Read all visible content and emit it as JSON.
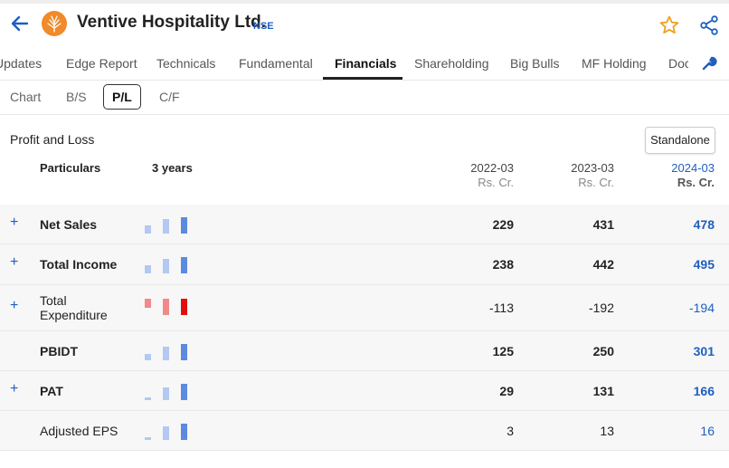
{
  "header": {
    "company_name": "Ventive Hospitality Ltd.",
    "exchange": "NSE",
    "icons": [
      "back-arrow-icon",
      "company-logo",
      "star-icon",
      "share-icon"
    ]
  },
  "tabs": [
    {
      "label": "Updates"
    },
    {
      "label": "Edge Report"
    },
    {
      "label": "Technicals"
    },
    {
      "label": "Fundamental"
    },
    {
      "label": "Financials",
      "active": true
    },
    {
      "label": "Shareholding"
    },
    {
      "label": "Big Bulls"
    },
    {
      "label": "MF Holding"
    },
    {
      "label": "Doc"
    }
  ],
  "subtabs": [
    {
      "label": "Chart"
    },
    {
      "label": "B/S"
    },
    {
      "label": "P/L",
      "active": true
    },
    {
      "label": "C/F"
    }
  ],
  "section": {
    "title": "Profit and Loss",
    "standalone_label": "Standalone"
  },
  "table": {
    "col_particulars": "Particulars",
    "col_years": "3 years",
    "periods": [
      {
        "year": "2022-03",
        "unit": "Rs. Cr."
      },
      {
        "year": "2023-03",
        "unit": "Rs. Cr."
      },
      {
        "year": "2024-03",
        "unit": "Rs. Cr."
      }
    ],
    "rows": [
      {
        "label": "Net Sales",
        "bold": true,
        "expandable": true,
        "values": [
          "229",
          "431",
          "478"
        ],
        "nums": [
          229,
          431,
          478
        ]
      },
      {
        "label": "Total Income",
        "bold": true,
        "expandable": true,
        "values": [
          "238",
          "442",
          "495"
        ],
        "nums": [
          238,
          442,
          495
        ]
      },
      {
        "label": "Total Expenditure",
        "bold": false,
        "expandable": true,
        "values": [
          "-113",
          "-192",
          "-194"
        ],
        "nums": [
          113,
          192,
          194
        ],
        "negative": true
      },
      {
        "label": "PBIDT",
        "bold": true,
        "expandable": false,
        "values": [
          "125",
          "250",
          "301"
        ],
        "nums": [
          125,
          250,
          301
        ]
      },
      {
        "label": "PAT",
        "bold": true,
        "expandable": true,
        "values": [
          "29",
          "131",
          "166"
        ],
        "nums": [
          29,
          131,
          166
        ]
      },
      {
        "label": "Adjusted EPS",
        "bold": false,
        "expandable": false,
        "values": [
          "3",
          "13",
          "16"
        ],
        "nums": [
          3,
          13,
          16
        ]
      }
    ]
  },
  "colors": {
    "accent": "#1f5fbf",
    "logo": "#f08a2a",
    "bar_pos_light": "#b3c8f2",
    "bar_pos_dark": "#5b8ae0",
    "bar_neg_light": "#f08a8a",
    "bar_neg_dark": "#e01010"
  }
}
